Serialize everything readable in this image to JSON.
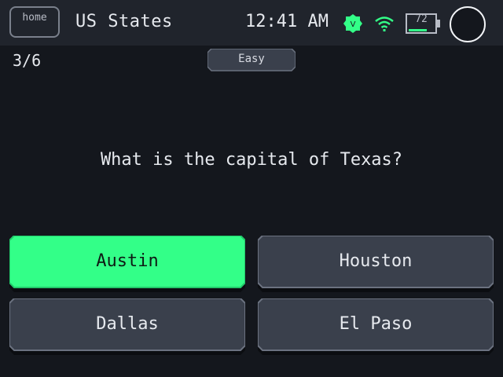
{
  "status_bar": {
    "home_label": "home",
    "app_title": "US States",
    "clock": "12:41 AM",
    "vpn_badge": "V",
    "battery_level": "72",
    "icons": [
      "vpn-icon",
      "wifi-icon",
      "battery-icon",
      "power-icon"
    ]
  },
  "quiz": {
    "progress": "3/6",
    "difficulty": "Easy",
    "question": "What is the capital of Texas?",
    "answers": [
      {
        "label": "Austin",
        "selected": true
      },
      {
        "label": "Houston",
        "selected": false
      },
      {
        "label": "Dallas",
        "selected": false
      },
      {
        "label": "El Paso",
        "selected": false
      }
    ]
  },
  "colors": {
    "background": "#14171d",
    "status_bar": "#20242c",
    "accent_green": "#33ff88",
    "button": "#3a404c"
  }
}
